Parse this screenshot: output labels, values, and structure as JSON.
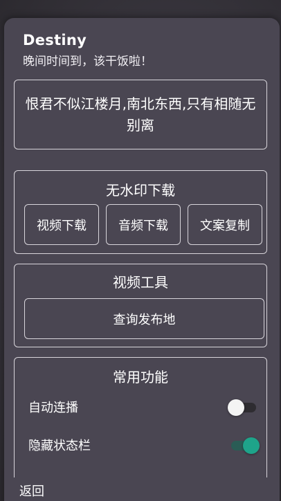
{
  "header": {
    "title": "Destiny",
    "subtitle": "晚间时间到，该干饭啦！"
  },
  "quote": {
    "text": "恨君不似江楼月,南北东西,只有相随无别离"
  },
  "download": {
    "title": "无水印下载",
    "video_label": "视频下载",
    "audio_label": "音频下载",
    "copy_label": "文案复制"
  },
  "tools": {
    "title": "视频工具",
    "query_label": "查询发布地"
  },
  "functions": {
    "title": "常用功能",
    "items": [
      {
        "label": "自动连播",
        "enabled": false
      },
      {
        "label": "隐藏状态栏",
        "enabled": true
      }
    ]
  },
  "footer": {
    "back_label": "返回"
  },
  "colors": {
    "toggle_on": "#1ea48a",
    "sheet_bg": "#4a4652"
  }
}
